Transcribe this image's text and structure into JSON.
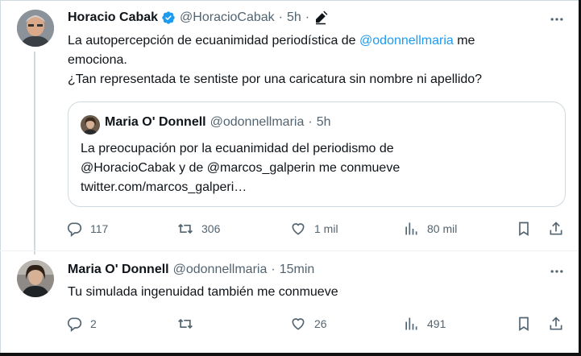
{
  "tweet1": {
    "name": "Horacio Cabak",
    "handle": "@HoracioCabak",
    "dot": "·",
    "time": "5h",
    "dot2": "·",
    "text_prefix": "La autopercepción de ecuanimidad periodística de ",
    "mention": "@odonnellmaria",
    "text_suffix": " me",
    "line2": "emociona.",
    "line3": "¿Tan representada te sentiste por una caricatura sin nombre ni apellido?",
    "quote": {
      "name": "Maria O' Donnell",
      "handle": "@odonnellmaria",
      "dot": "·",
      "time": "5h",
      "line1": "La preocupación por la ecuanimidad del periodismo de",
      "line2": "@HoracioCabak y de @marcos_galperin me conmueve",
      "line3": "twitter.com/marcos_galperi…"
    },
    "replies": "117",
    "retweets": "306",
    "likes": "1 mil",
    "views": "80 mil"
  },
  "tweet2": {
    "name": "Maria O' Donnell",
    "handle": "@odonnellmaria",
    "dot": "·",
    "time": "15min",
    "text": "Tu simulada ingenuidad también me conmueve",
    "replies": "2",
    "retweets": "",
    "likes": "26",
    "views": "491"
  },
  "colors": {
    "accent": "#1d9bf0",
    "secondary_text": "#536471",
    "border": "#cfd9de"
  },
  "icons": [
    "verified-badge-icon",
    "edit-pencil-icon",
    "more-options-icon",
    "reply-icon",
    "retweet-icon",
    "like-icon",
    "views-icon",
    "bookmark-icon",
    "share-icon"
  ]
}
